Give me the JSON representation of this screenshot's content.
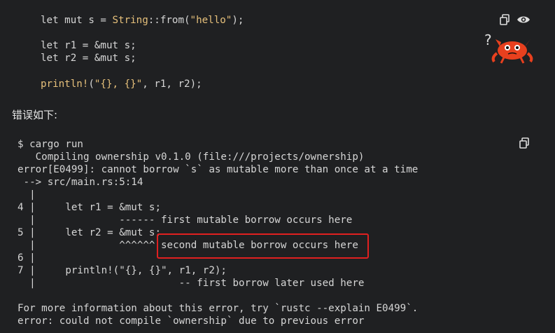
{
  "code1": {
    "lines": [
      {
        "parts": [
          {
            "t": "let mut s = ",
            "c": "kw"
          },
          {
            "t": "String",
            "c": "ty"
          },
          {
            "t": "::from(",
            "c": "kw"
          },
          {
            "t": "\"hello\"",
            "c": "str"
          },
          {
            "t": ");",
            "c": "kw"
          }
        ]
      },
      {
        "parts": [
          {
            "t": "let r1 = &mut s;",
            "c": "kw"
          }
        ]
      },
      {
        "parts": [
          {
            "t": "let r2 = &mut s;",
            "c": "kw"
          }
        ]
      },
      {
        "parts": [
          {
            "t": "println!",
            "c": "mac"
          },
          {
            "t": "(",
            "c": "kw"
          },
          {
            "t": "\"{}, {}\"",
            "c": "str"
          },
          {
            "t": ", r1, r2);",
            "c": "kw"
          }
        ]
      }
    ]
  },
  "prose": {
    "text": "错误如下:"
  },
  "code2": {
    "lines": [
      "$ cargo run",
      "   Compiling ownership v0.1.0 (file:///projects/ownership)",
      "error[E0499]: cannot borrow `s` as mutable more than once at a time",
      " --> src/main.rs:5:14",
      "  |",
      "4 |     let r1 = &mut s;",
      "  |              ------ first mutable borrow occurs here",
      "5 |     let r2 = &mut s;",
      "  |              ^^^^^^ second mutable borrow occurs here",
      "6 |",
      "7 |     println!(\"{}, {}\", r1, r2);",
      "  |                        -- first borrow later used here",
      "",
      "For more information about this error, try `rustc --explain E0499`.",
      "error: could not compile `ownership` due to previous error"
    ]
  },
  "icons": {
    "copy": "copy-icon",
    "eye": "eye-icon",
    "ferris": "ferris-does-not-compile-icon",
    "question": "?"
  },
  "colors": {
    "background": "#1f2022",
    "highlight": "#e02020",
    "accent": "#e6c07b"
  }
}
